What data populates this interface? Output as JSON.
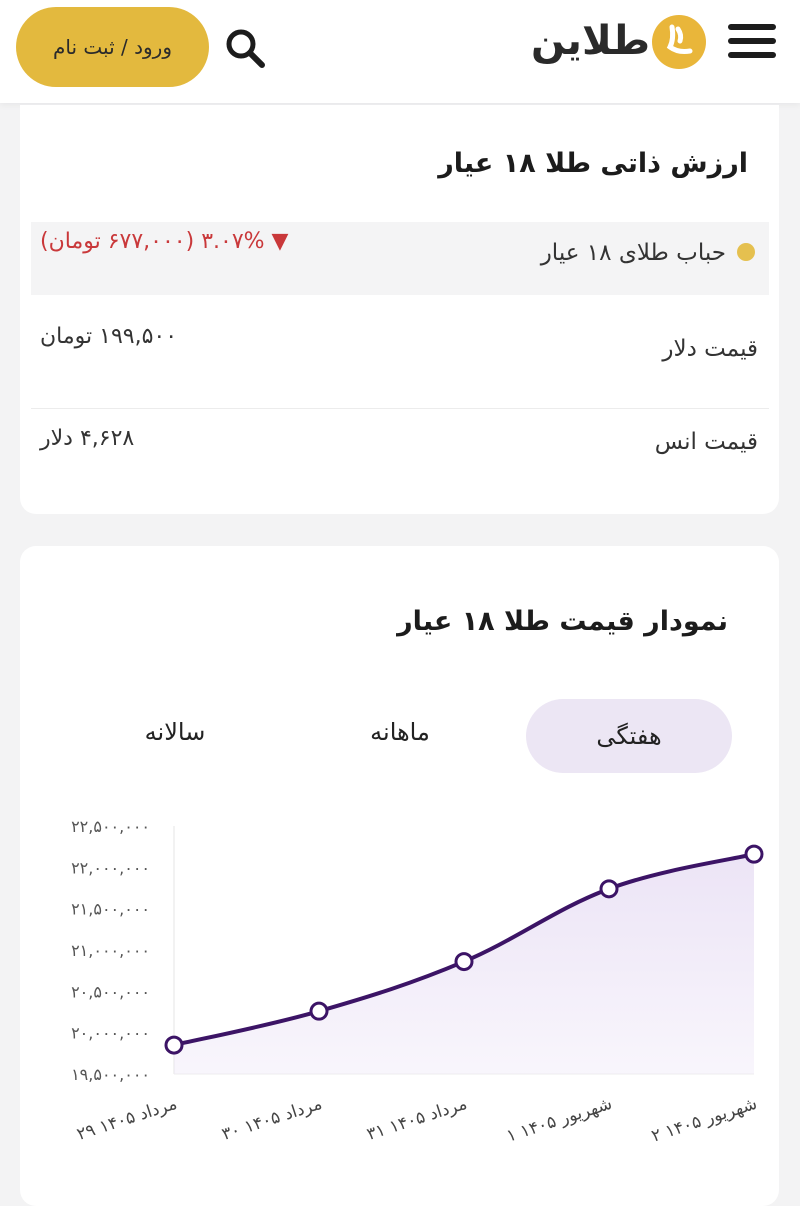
{
  "header": {
    "login_label": "ورود / ثبت نام",
    "logo_text": "طلاین",
    "icons": {
      "search": "search-icon",
      "menu": "menu-icon",
      "logo": "logo-mark-icon"
    },
    "accent_color": "#e3b93e"
  },
  "value_card": {
    "title": "ارزش ذاتی طلا ۱۸ عیار",
    "bubble": {
      "label": "حباب طلای ۱۸ عیار",
      "value": "▼  ۳.۰۷% (۶۷۷,۰۰۰ تومان)",
      "status_color": "#c9383a"
    },
    "dollar": {
      "label": "قیمت دلار",
      "value": "۱۹۹,۵۰۰ تومان"
    },
    "ounce": {
      "label": "قیمت انس",
      "value": "۴,۶۲۸ دلار"
    }
  },
  "chart_card": {
    "title": "نمودار قیمت طلا ۱۸ عیار",
    "tabs": [
      {
        "label": "هفتگی",
        "active": true
      },
      {
        "label": "ماهانه",
        "active": false
      },
      {
        "label": "سالانه",
        "active": false
      }
    ]
  },
  "chart_data": {
    "type": "area",
    "x": [
      "۲۹ مرداد ۱۴۰۵",
      "۳۰ مرداد ۱۴۰۵",
      "۳۱ مرداد ۱۴۰۵",
      "۱ شهریور ۱۴۰۵",
      "۲ شهریور ۱۴۰۵"
    ],
    "series": [
      {
        "values": [
          19850000,
          20260000,
          20860000,
          21740000,
          22160000
        ]
      }
    ],
    "yticks": [
      19500000,
      20000000,
      20500000,
      21000000,
      21500000,
      22000000,
      22500000
    ],
    "ytick_labels": [
      "۱۹,۵۰۰,۰۰۰",
      "۲۰,۰۰۰,۰۰۰",
      "۲۰,۵۰۰,۰۰۰",
      "۲۱,۰۰۰,۰۰۰",
      "۲۱,۵۰۰,۰۰۰",
      "۲۲,۰۰۰,۰۰۰",
      "۲۲,۵۰۰,۰۰۰"
    ],
    "ylim": [
      19500000,
      22500000
    ],
    "line_color": "#3c1466",
    "fill_color": "#ece4f6",
    "grid": false,
    "legend": "none"
  }
}
